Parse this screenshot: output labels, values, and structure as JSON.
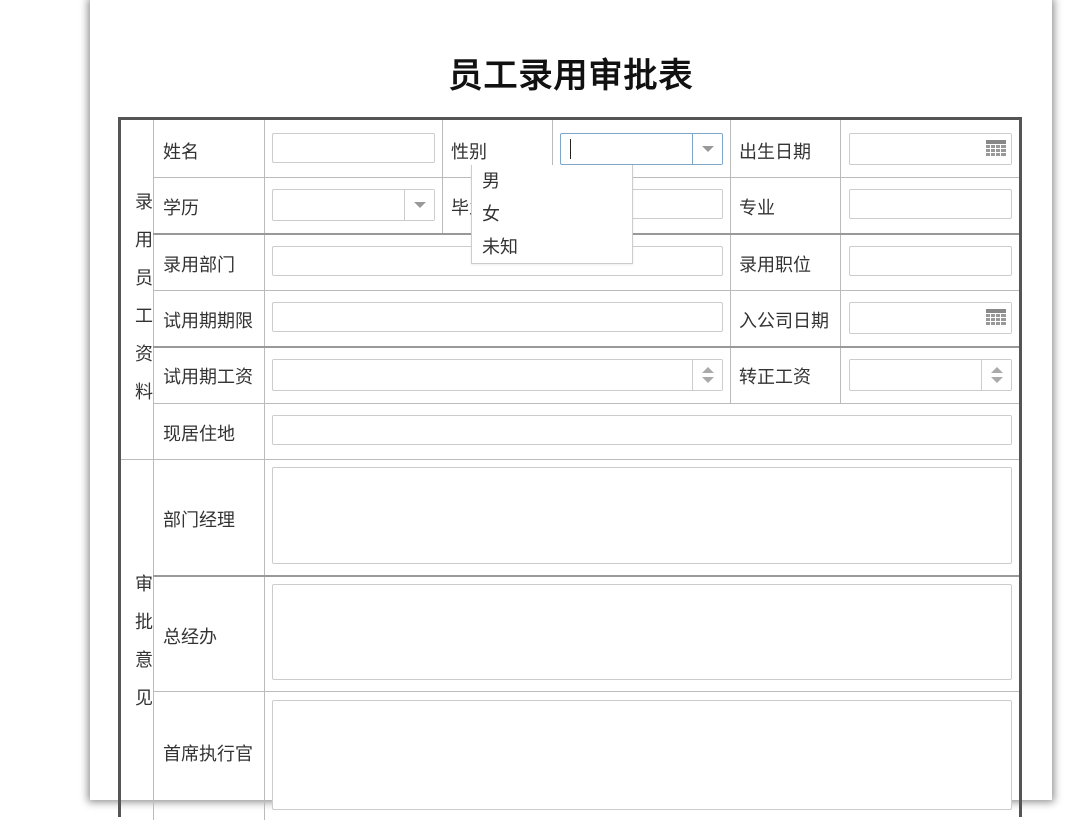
{
  "form": {
    "title": "员工录用审批表",
    "sections": {
      "employee_info": "录用员工资料",
      "approval": "审批意见"
    },
    "labels": {
      "name": "姓名",
      "gender": "性别",
      "birth_date": "出生日期",
      "education": "学历",
      "school": "毕业院校",
      "major": "专业",
      "department": "录用部门",
      "position": "录用职位",
      "probation_period": "试用期期限",
      "join_date": "入公司日期",
      "probation_salary": "试用期工资",
      "regular_salary": "转正工资",
      "address": "现居住地",
      "dept_manager": "部门经理",
      "general_office": "总经办",
      "ceo": "首席执行官"
    },
    "gender_dropdown": {
      "value": "",
      "options": [
        "男",
        "女",
        "未知"
      ]
    }
  },
  "colors": {
    "frame_border": "#555555",
    "cell_border": "#bbbbbb",
    "input_border": "#cccccc",
    "focus_border": "#7ea6c8"
  }
}
